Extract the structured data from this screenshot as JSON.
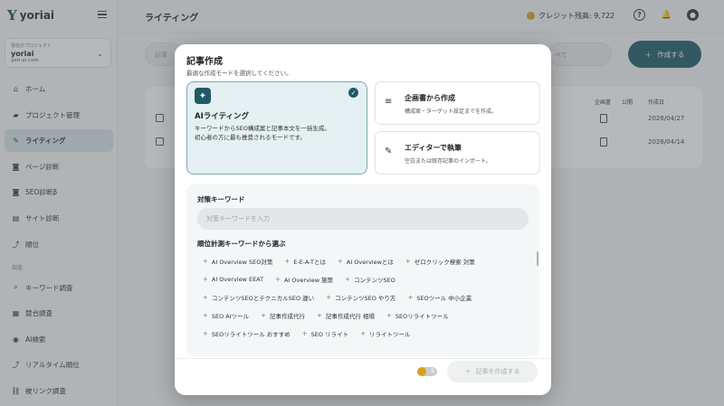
{
  "app": {
    "logo_text": "yoriai"
  },
  "sidebar": {
    "project_label": "現在のプロジェクト",
    "project_name": "yoriai",
    "project_url": "yori-ai.com",
    "items": [
      {
        "label": "ホーム",
        "icon": "home-icon",
        "glyph": "⌂"
      },
      {
        "label": "プロジェクト管理",
        "icon": "folder-icon",
        "glyph": "▰"
      },
      {
        "label": "ライティング",
        "icon": "pen-icon",
        "glyph": "✎",
        "active": true
      },
      {
        "label": "ページ診断",
        "icon": "page-check-icon",
        "glyph": "◙"
      },
      {
        "label": "SEO診断β",
        "icon": "seo-check-icon",
        "glyph": "◙"
      },
      {
        "label": "サイト診断",
        "icon": "site-icon",
        "glyph": "▤"
      },
      {
        "label": "順位",
        "icon": "rank-chart-icon",
        "glyph": "⤴"
      }
    ],
    "section_label": "調査",
    "research_items": [
      {
        "label": "キーワード調査",
        "icon": "keyword-icon",
        "glyph": "⌕"
      },
      {
        "label": "競合調査",
        "icon": "competitor-icon",
        "glyph": "▦"
      },
      {
        "label": "AI検索",
        "icon": "ai-search-icon",
        "glyph": "◉"
      },
      {
        "label": "リアルタイム順位",
        "icon": "realtime-icon",
        "glyph": "⤴"
      },
      {
        "label": "被リンク調査",
        "icon": "backlink-icon",
        "glyph": "⛓"
      }
    ]
  },
  "header": {
    "title": "ライティング",
    "credit_text": "クレジット残高: 9,722",
    "help_glyph": "?",
    "bell_glyph": "🔔",
    "user_glyph": "●"
  },
  "main": {
    "search_placeholder": "記事",
    "select_value": "べて",
    "create_button": "作成する",
    "columns": [
      "企画書",
      "公開",
      "作成日"
    ],
    "rows": [
      {
        "date": "2026/04/27"
      },
      {
        "date": "2026/04/14"
      }
    ]
  },
  "modal": {
    "title": "記事作成",
    "subtitle": "最適な作成モードを選択してください。",
    "ai_mode": {
      "title": "AIライティング",
      "desc1": "キーワードからSEO構成案と記事本文を一括生成。",
      "desc2": "初心者の方に最も推奨されるモードです。"
    },
    "plan_mode": {
      "title": "企画書から作成",
      "desc": "構成案・ターゲット設定までを作成。"
    },
    "editor_mode": {
      "title": "エディターで執筆",
      "desc": "空白または既存記事のインポート。"
    },
    "keyword_label": "対策キーワード",
    "keyword_placeholder": "対策キーワードを入力",
    "rank_label": "順位計測キーワードから選ぶ",
    "chip_rows": [
      [
        "AI Overview SEO対策",
        "E-E-A-Tとは",
        "AI Overviewとは",
        "ゼロクリック検索 対策"
      ],
      [
        "AI Overview EEAT",
        "AI Overview 施策",
        "コンテンツSEO"
      ],
      [
        "コンテンツSEOとテクニカルSEO 違い",
        "コンテンツSEO やり方",
        "SEOツール 中小企業"
      ],
      [
        "SEO AIツール",
        "記事作成代行",
        "記事作成代行 相場",
        "SEOリライトツール"
      ],
      [
        "SEOリライトツール おすすめ",
        "SEO リライト",
        "リライトツール"
      ]
    ],
    "toggle_value": "5",
    "submit_label": "記事を作成する"
  }
}
